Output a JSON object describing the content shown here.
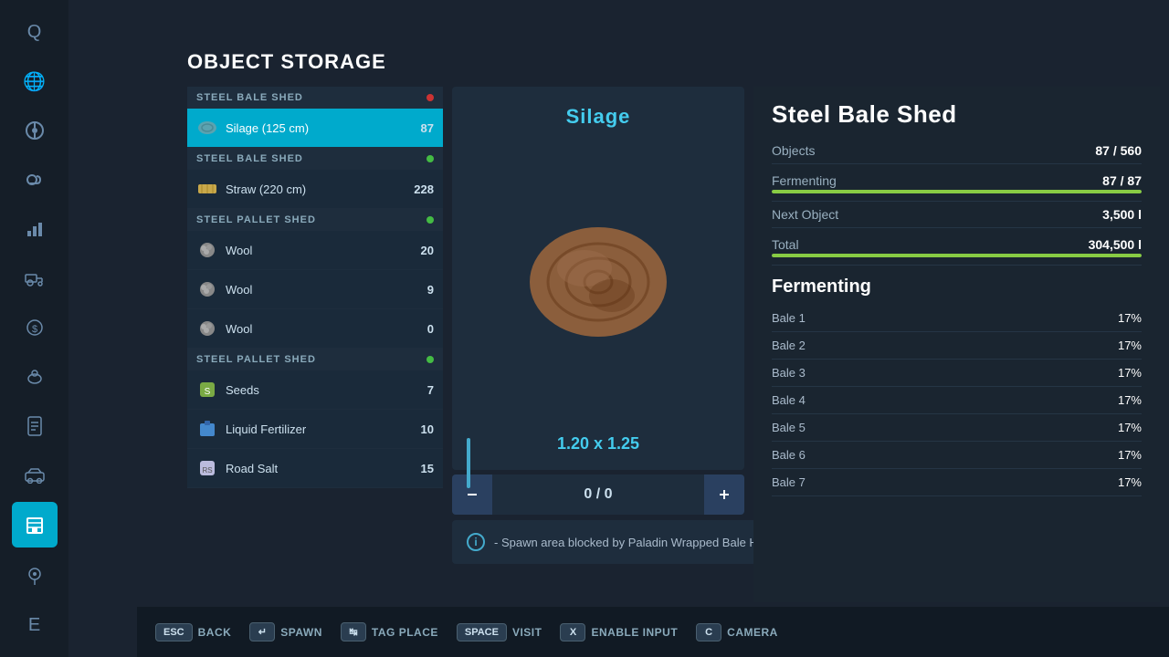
{
  "page": {
    "title": "OBJECT STORAGE"
  },
  "sidebar": {
    "items": [
      {
        "id": "q",
        "label": "Q",
        "icon": "Q",
        "active": false
      },
      {
        "id": "globe",
        "label": "Globe",
        "icon": "🌐",
        "active": false
      },
      {
        "id": "wheel",
        "label": "Steering Wheel",
        "icon": "⚙",
        "active": false
      },
      {
        "id": "weather",
        "label": "Weather",
        "icon": "☁",
        "active": false
      },
      {
        "id": "stats",
        "label": "Stats",
        "icon": "📊",
        "active": false
      },
      {
        "id": "tractor",
        "label": "Tractor",
        "icon": "🚜",
        "active": false
      },
      {
        "id": "money",
        "label": "Money",
        "icon": "💲",
        "active": false
      },
      {
        "id": "animals",
        "label": "Animals",
        "icon": "🐄",
        "active": false
      },
      {
        "id": "contracts",
        "label": "Contracts",
        "icon": "📋",
        "active": false
      },
      {
        "id": "vehicle",
        "label": "Vehicle",
        "icon": "🚗",
        "active": false
      },
      {
        "id": "storage",
        "label": "Storage",
        "icon": "🏛",
        "active": true
      },
      {
        "id": "map",
        "label": "Map",
        "icon": "🗺",
        "active": false
      },
      {
        "id": "e",
        "label": "E",
        "icon": "E",
        "active": false
      }
    ]
  },
  "sections": [
    {
      "id": "steel-bale-shed-1",
      "header": "STEEL BALE SHED",
      "dot_color": "red",
      "items": [
        {
          "name": "Silage (125 cm)",
          "count": "87",
          "type": "silage",
          "selected": true
        }
      ]
    },
    {
      "id": "steel-bale-shed-2",
      "header": "STEEL BALE SHED",
      "dot_color": "green",
      "items": [
        {
          "name": "Straw (220 cm)",
          "count": "228",
          "type": "straw",
          "selected": false
        }
      ]
    },
    {
      "id": "steel-pallet-shed-1",
      "header": "STEEL PALLET SHED",
      "dot_color": "green",
      "items": [
        {
          "name": "Wool",
          "count": "20",
          "type": "wool",
          "selected": false
        },
        {
          "name": "Wool",
          "count": "9",
          "type": "wool",
          "selected": false
        },
        {
          "name": "Wool",
          "count": "0",
          "type": "wool",
          "selected": false
        }
      ]
    },
    {
      "id": "steel-pallet-shed-2",
      "header": "STEEL PALLET SHED",
      "dot_color": "green",
      "items": [
        {
          "name": "Seeds",
          "count": "7",
          "type": "seeds",
          "selected": false
        },
        {
          "name": "Liquid Fertilizer",
          "count": "10",
          "type": "fertilizer",
          "selected": false
        },
        {
          "name": "Road Salt",
          "count": "15",
          "type": "salt",
          "selected": false
        }
      ]
    }
  ],
  "preview": {
    "item_name": "Silage",
    "dimensions": "1.20 x 1.25",
    "quantity_current": "0",
    "quantity_max": "0"
  },
  "shed_info": {
    "title": "Steel Bale Shed",
    "stats": [
      {
        "label": "Objects",
        "value": "87 / 560"
      },
      {
        "label": "Fermenting",
        "value": "87 / 87",
        "has_bar": true,
        "bar_pct": 100
      },
      {
        "label": "Next Object",
        "value": "3,500 l"
      },
      {
        "label": "Total",
        "value": "304,500 l",
        "has_bar": true,
        "bar_pct": 100
      }
    ],
    "fermenting_title": "Fermenting",
    "bales": [
      {
        "name": "Bale 1",
        "pct": "17%"
      },
      {
        "name": "Bale 2",
        "pct": "17%"
      },
      {
        "name": "Bale 3",
        "pct": "17%"
      },
      {
        "name": "Bale 4",
        "pct": "17%"
      },
      {
        "name": "Bale 5",
        "pct": "17%"
      },
      {
        "name": "Bale 6",
        "pct": "17%"
      },
      {
        "name": "Bale 7",
        "pct": "17%"
      }
    ]
  },
  "warning": {
    "text": "- Spawn area blocked by Paladin Wrapped Bale Handler!"
  },
  "bottom_bar": {
    "keys": [
      {
        "key": "ESC",
        "label": "BACK"
      },
      {
        "key": "↵",
        "label": "SPAWN"
      },
      {
        "key": "↹",
        "label": "TAG PLACE"
      },
      {
        "key": "SPACE",
        "label": "VISIT"
      },
      {
        "key": "X",
        "label": "ENABLE INPUT"
      },
      {
        "key": "C",
        "label": "CAMERA"
      }
    ]
  }
}
